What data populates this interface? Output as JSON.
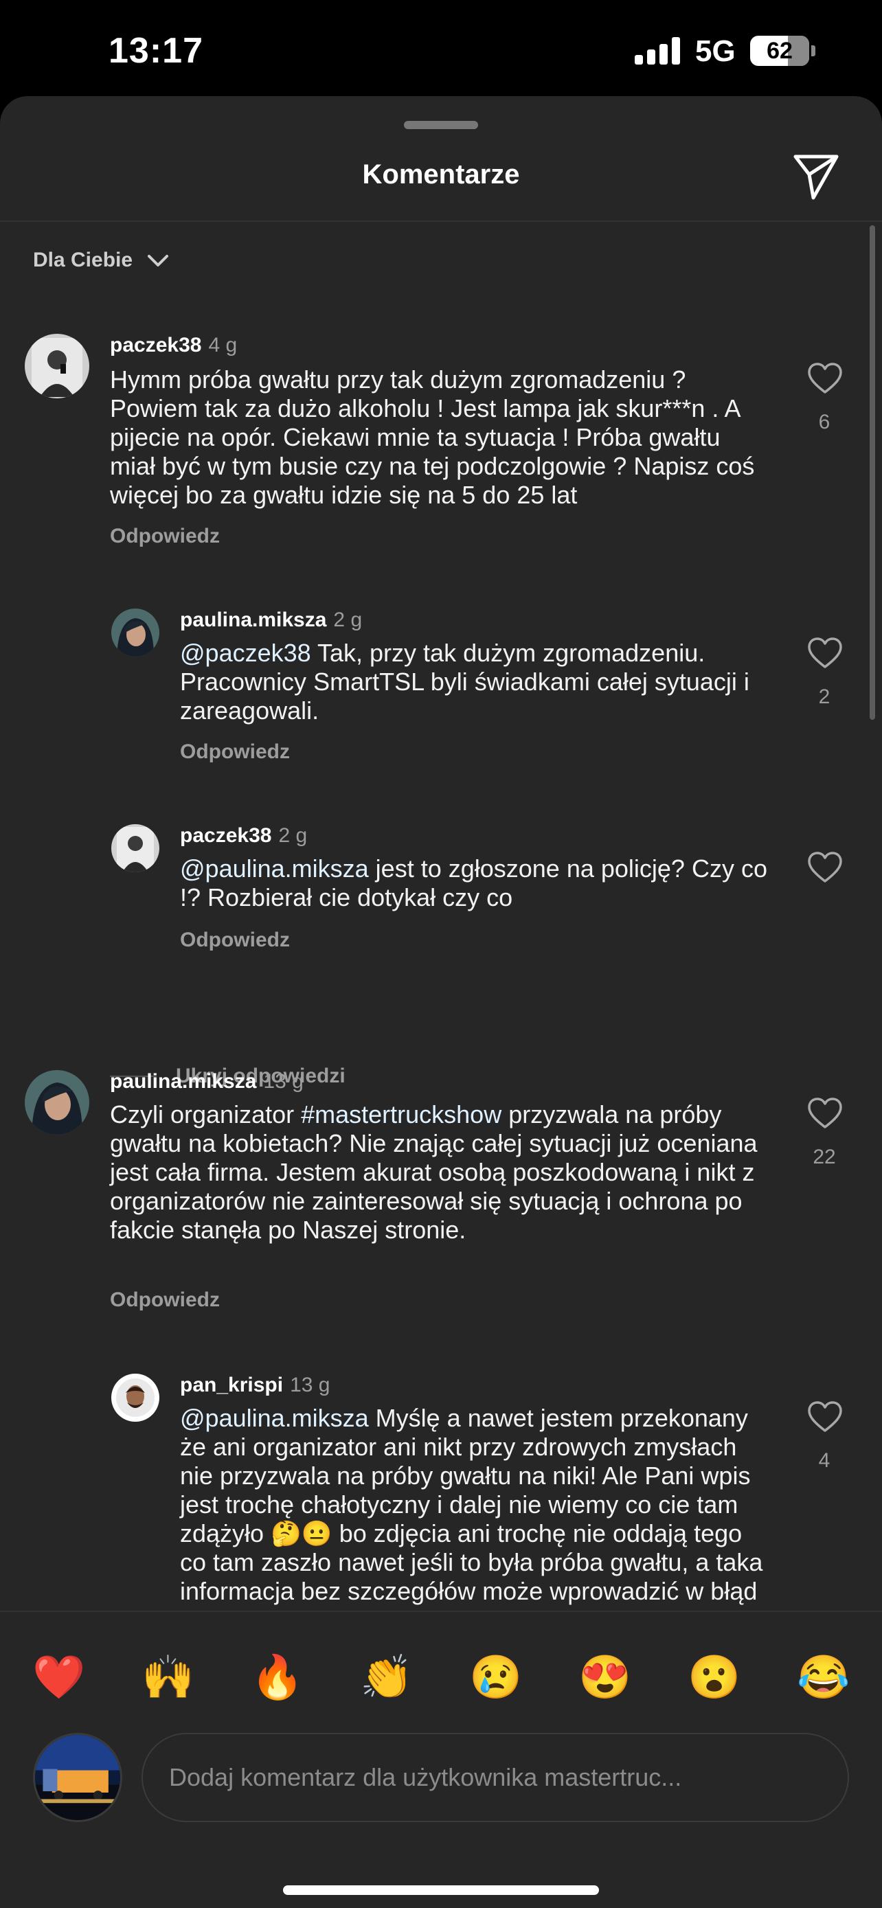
{
  "status_bar": {
    "time": "13:17",
    "network": "5G",
    "battery": "62"
  },
  "sheet": {
    "title": "Komentarze",
    "filter_label": "Dla Ciebie"
  },
  "comments": [
    {
      "username": "paczek38",
      "time": "4 g",
      "text": "Hymm próba gwałtu przy tak dużym zgromadzeniu ? Powiem tak za dużo alkoholu ! Jest lampa jak skur***n . A pijecie na opór.  Ciekawi mnie ta sytuacja ! Próba gwałtu miał być w tym busie czy na tej podczolgowie ? Napisz coś więcej bo za gwałtu idzie się na 5 do 25 lat",
      "reply": "Odpowiedz",
      "likes": "6"
    },
    {
      "username": "paulina.miksza",
      "time": "2 g",
      "mention": "@paczek38",
      "text": " Tak, przy tak dużym zgromadzeniu. Pracownicy SmartTSL byli świadkami całej sytuacji i zareagowali.",
      "reply": "Odpowiedz",
      "likes": "2"
    },
    {
      "username": "paczek38",
      "time": "2 g",
      "mention": "@paulina.miksza",
      "text": " jest to zgłoszone na policję? Czy co !? Rozbierał cie dotykał czy co",
      "reply": "Odpowiedz",
      "likes": ""
    },
    {
      "username": "paulina.miksza",
      "time": "13 g",
      "text_before": "Czyli organizator ",
      "mention": "#mastertruckshow",
      "text": " przyzwala na próby gwałtu na kobietach? Nie znając całej sytuacji już oceniana jest cała firma. Jestem akurat osobą poszkodowaną i nikt z organizatorów nie zainteresował się sytuacją i ochrona po fakcie stanęła po Naszej stronie.",
      "reply": "Odpowiedz",
      "likes": "22"
    },
    {
      "username": "pan_krispi",
      "time": "13 g",
      "mention": "@paulina.miksza",
      "text": " Myślę a nawet jestem przekonany że ani organizator ani nikt przy zdrowych zmysłach nie przyzwala na próby gwałtu na niki! Ale Pani wpis jest trochę chałotyczny i dalej nie wiemy co cie tam zdążyło 🤔😐 bo zdjęcia ani trochę nie oddają tego co tam zaszło nawet jeśli to była próba gwałtu, a taka informacja bez szczegółów może wprowadzić w błąd",
      "likes": "4"
    }
  ],
  "hide_replies_label": "Ukryj odpowiedzi",
  "emoji_reactions": [
    "❤️",
    "🙌",
    "🔥",
    "👏",
    "😢",
    "😍",
    "😮",
    "😂"
  ],
  "composer": {
    "placeholder": "Dodaj komentarz dla użytkownika mastertruc..."
  },
  "colors": {
    "background": "#262626",
    "mention": "#e0f1ff",
    "muted": "#9d9d9d"
  }
}
